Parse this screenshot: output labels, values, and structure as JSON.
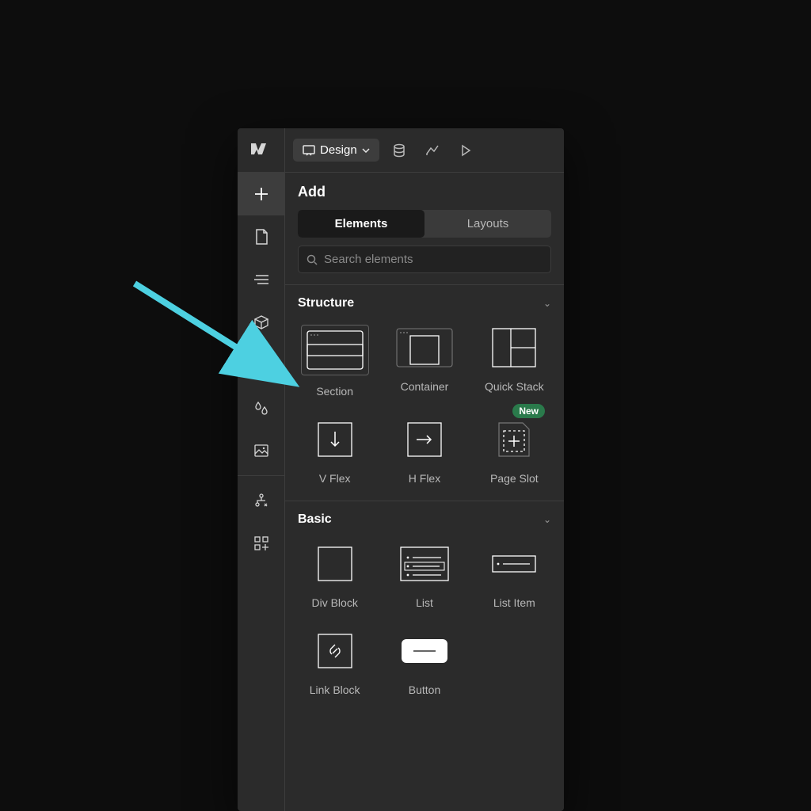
{
  "topbar": {
    "mode_label": "Design"
  },
  "panel": {
    "title": "Add",
    "tabs": [
      "Elements",
      "Layouts"
    ],
    "active_tab": 0,
    "search_placeholder": "Search elements"
  },
  "groups": [
    {
      "name": "Structure",
      "items": [
        {
          "label": "Section",
          "highlighted": true
        },
        {
          "label": "Container"
        },
        {
          "label": "Quick Stack"
        },
        {
          "label": "V Flex"
        },
        {
          "label": "H Flex"
        },
        {
          "label": "Page Slot",
          "badge": "New"
        }
      ]
    },
    {
      "name": "Basic",
      "items": [
        {
          "label": "Div Block"
        },
        {
          "label": "List"
        },
        {
          "label": "List Item"
        },
        {
          "label": "Link Block"
        },
        {
          "label": "Button"
        }
      ]
    }
  ],
  "colors": {
    "arrow": "#4dd0e1",
    "badge": "#2a7a4b"
  }
}
